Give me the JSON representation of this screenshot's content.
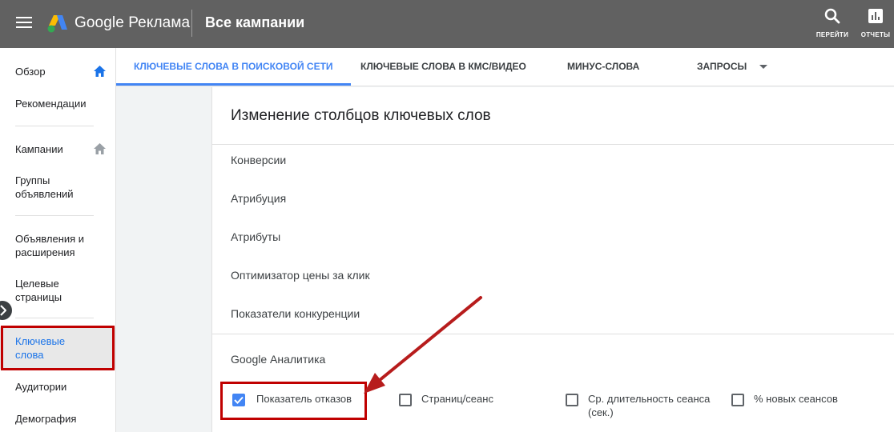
{
  "header": {
    "brand": "Google Реклама",
    "title": "Все кампании",
    "actions": {
      "go_label": "ПЕРЕЙТИ",
      "reports_label": "ОТЧЕТЫ"
    }
  },
  "sidebar": {
    "items": [
      {
        "label": "Обзор"
      },
      {
        "label": "Рекомендации"
      },
      {
        "label": "Кампании"
      },
      {
        "label": "Группы объявлений"
      },
      {
        "label": "Объявления и расширения"
      },
      {
        "label": "Целевые страницы"
      },
      {
        "label": "Ключевые слова"
      },
      {
        "label": "Аудитории"
      },
      {
        "label": "Демография"
      }
    ]
  },
  "tabs": [
    {
      "label": "КЛЮЧЕВЫЕ СЛОВА В ПОИСКОВОЙ СЕТИ"
    },
    {
      "label": "КЛЮЧЕВЫЕ СЛОВА В КМС/ВИДЕО"
    },
    {
      "label": "МИНУС-СЛОВА"
    },
    {
      "label": "ЗАПРОСЫ"
    }
  ],
  "panel": {
    "title": "Изменение столбцов ключевых слов",
    "categories": [
      {
        "label": "Конверсии"
      },
      {
        "label": "Атрибуция"
      },
      {
        "label": "Атрибуты"
      },
      {
        "label": "Оптимизатор цены за клик"
      },
      {
        "label": "Показатели конкуренции"
      },
      {
        "label": "Google Аналитика"
      }
    ],
    "checkboxes": [
      {
        "label": "Показатель отказов",
        "checked": true
      },
      {
        "label": "Страниц/сеанс",
        "checked": false
      },
      {
        "label": "Ср. длительность сеанса",
        "label2": "(сек.)",
        "checked": false
      },
      {
        "label": "% новых сеансов",
        "checked": false
      }
    ]
  },
  "colors": {
    "topbar": "#616161",
    "accent": "#4285f4",
    "highlight": "#c00000"
  }
}
